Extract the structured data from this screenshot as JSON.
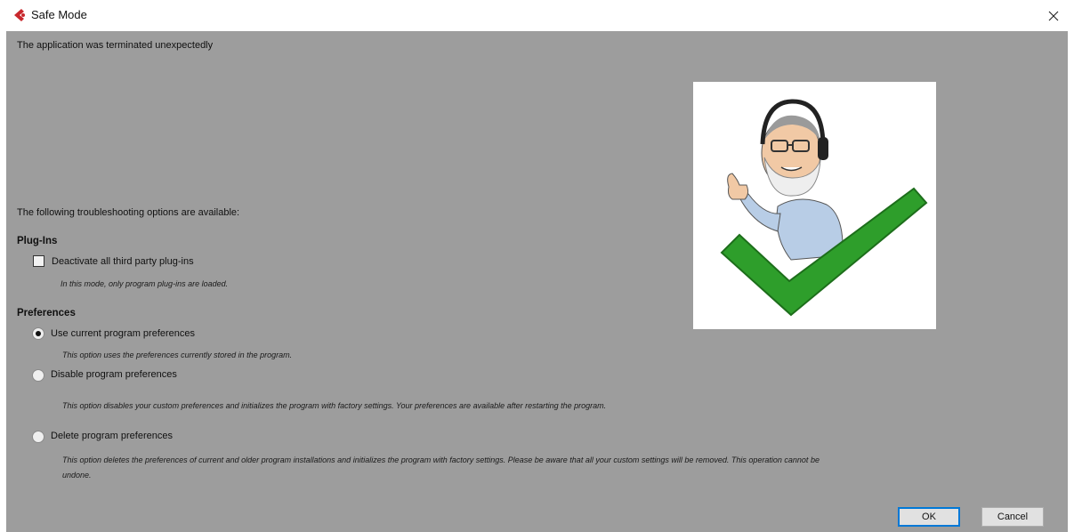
{
  "window": {
    "title": "Safe Mode",
    "close_icon": "close-icon",
    "app_icon": "app-logo-icon"
  },
  "dialog": {
    "message": "The application was terminated unexpectedly",
    "options_intro": "The following troubleshooting options are available:"
  },
  "plugins": {
    "heading": "Plug-Ins",
    "deactivate_label": "Deactivate all third party plug-ins",
    "deactivate_checked": false,
    "deactivate_desc": "In this mode, only program plug-ins are loaded."
  },
  "preferences": {
    "heading": "Preferences",
    "options": [
      {
        "label": "Use current program preferences",
        "selected": true,
        "desc": "This option uses the preferences currently stored in the program."
      },
      {
        "label": "Disable program preferences",
        "selected": false,
        "desc": "This option disables your custom preferences and initializes the program with factory settings. Your preferences are available after restarting the program."
      },
      {
        "label": "Delete program preferences",
        "selected": false,
        "desc": "This option deletes the preferences of current and older program installations and initializes the program with factory settings. Please be aware that all your custom settings will be removed. This operation cannot be",
        "desc_cont": "undone."
      }
    ]
  },
  "buttons": {
    "ok": "OK",
    "cancel": "Cancel"
  },
  "colors": {
    "content_bg": "#9d9d9d",
    "logo_red": "#c8282d",
    "check_green": "#2e9e2b",
    "ok_border": "#0078d7"
  }
}
